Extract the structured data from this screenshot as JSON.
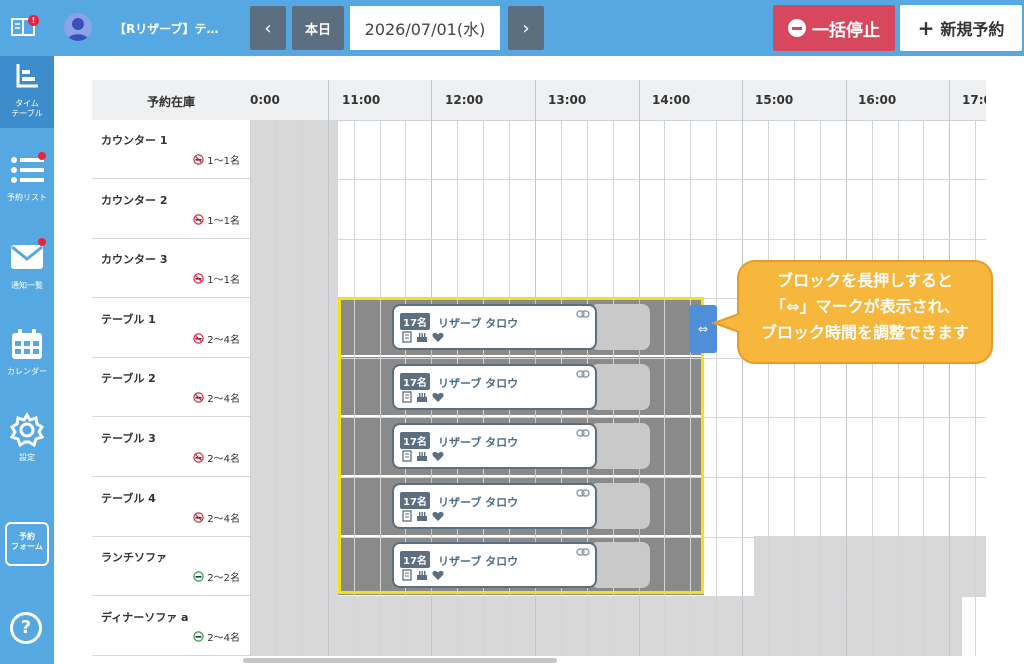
{
  "header": {
    "store_name": "【Rリザーブ】テ…",
    "prev_label": "‹",
    "today_label": "本日",
    "date": "2026/07/01(水)",
    "next_label": "›",
    "stop_all_label": "一括停止",
    "new_reservation_label": "新規予約",
    "notification_badge": "!"
  },
  "sidebar": {
    "items": [
      {
        "label": "タイム\nテーブル",
        "icon": "timetable-icon"
      },
      {
        "label": "予約リスト",
        "icon": "list-icon"
      },
      {
        "label": "通知一覧",
        "icon": "mail-icon"
      },
      {
        "label": "カレンダー",
        "icon": "calendar-icon"
      },
      {
        "label": "設定",
        "icon": "gear-icon"
      },
      {
        "label": "予約\nフォーム",
        "icon": "form-icon"
      },
      {
        "label": "",
        "icon": "help-icon"
      }
    ]
  },
  "grid": {
    "corner_label": "予約在庫",
    "hours": [
      "0:00",
      "11:00",
      "12:00",
      "13:00",
      "14:00",
      "15:00",
      "16:00",
      "17:0"
    ],
    "rows": [
      {
        "name": "カウンター 1",
        "capacity": "1〜1名",
        "smoking": false
      },
      {
        "name": "カウンター 2",
        "capacity": "1〜1名",
        "smoking": false
      },
      {
        "name": "カウンター 3",
        "capacity": "1〜1名",
        "smoking": false
      },
      {
        "name": "テーブル 1",
        "capacity": "2〜4名",
        "smoking": false
      },
      {
        "name": "テーブル 2",
        "capacity": "2〜4名",
        "smoking": false
      },
      {
        "name": "テーブル 3",
        "capacity": "2〜4名",
        "smoking": false
      },
      {
        "name": "テーブル 4",
        "capacity": "2〜4名",
        "smoking": false
      },
      {
        "name": "ランチソファ",
        "capacity": "2〜2名",
        "smoking": true
      },
      {
        "name": "ディナーソファ a",
        "capacity": "2〜4名",
        "smoking": true
      }
    ],
    "reservations": [
      {
        "party": "17名",
        "name": "リザーブ タロウ"
      },
      {
        "party": "17名",
        "name": "リザーブ タロウ"
      },
      {
        "party": "17名",
        "name": "リザーブ タロウ"
      },
      {
        "party": "17名",
        "name": "リザーブ タロウ"
      },
      {
        "party": "17名",
        "name": "リザーブ タロウ"
      }
    ]
  },
  "handle_label": "⇔",
  "callout": {
    "line1": "ブロックを長押しすると",
    "line2": "「⇔」マークが表示され、",
    "line3": "ブロック時間を調整できます"
  },
  "colors": {
    "topbar": "#55a8e1",
    "stop_button": "#d7485e",
    "nav_button": "#5b6f80",
    "highlight": "#f2e21a",
    "callout": "#f6b73c",
    "handle": "#4f8fd8"
  }
}
